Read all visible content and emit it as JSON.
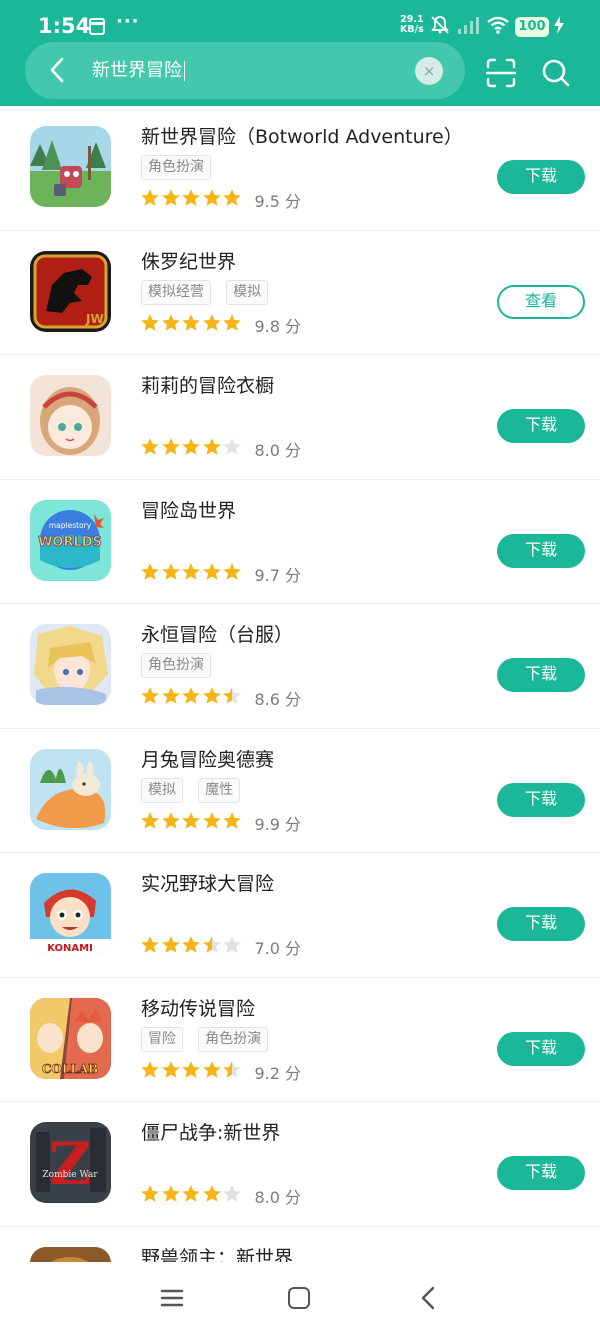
{
  "status": {
    "time": "1:54",
    "dots": "···",
    "speed_value": "29.1",
    "speed_unit": "KB/s",
    "battery": "100"
  },
  "search": {
    "query": "新世界冒险",
    "clear_label": "×"
  },
  "apps": [
    {
      "name": "新世界冒险（Botworld Adventure）",
      "tags": [
        "角色扮演"
      ],
      "rating": 5,
      "score": "9.5 分",
      "action": "下载",
      "style": "filled"
    },
    {
      "name": "侏罗纪世界",
      "tags": [
        "模拟经营",
        "模拟"
      ],
      "rating": 5,
      "score": "9.8 分",
      "action": "查看",
      "style": "outline"
    },
    {
      "name": "莉莉的冒险衣橱",
      "tags": [],
      "rating": 4,
      "score": "8.0 分",
      "action": "下载",
      "style": "filled"
    },
    {
      "name": "冒险岛世界",
      "tags": [],
      "rating": 5,
      "score": "9.7 分",
      "action": "下载",
      "style": "filled"
    },
    {
      "name": "永恒冒险（台服）",
      "tags": [
        "角色扮演"
      ],
      "rating": 4.5,
      "score": "8.6 分",
      "action": "下载",
      "style": "filled"
    },
    {
      "name": "月兔冒险奥德赛",
      "tags": [
        "模拟",
        "魔性"
      ],
      "rating": 5,
      "score": "9.9 分",
      "action": "下载",
      "style": "filled"
    },
    {
      "name": "实况野球大冒险",
      "tags": [],
      "rating": 3.5,
      "score": "7.0 分",
      "action": "下载",
      "style": "filled"
    },
    {
      "name": "移动传说冒险",
      "tags": [
        "冒险",
        "角色扮演"
      ],
      "rating": 4.5,
      "score": "9.2 分",
      "action": "下载",
      "style": "filled"
    },
    {
      "name": "僵尸战争:新世界",
      "tags": [],
      "rating": 4,
      "score": "8.0 分",
      "action": "下载",
      "style": "filled"
    },
    {
      "name": "野兽领主：新世界",
      "tags": [],
      "rating": 0,
      "score": "",
      "action": "",
      "style": "filled"
    }
  ],
  "icon_texts": {
    "jurassic": "JW",
    "maplestory_top": "maplestory",
    "maplestory_main": "WORLDS",
    "konami": "KONAMI",
    "collab": "COLLAB",
    "zombie_letter": "Z",
    "zombie_word": "Zombie War"
  },
  "colors": {
    "primary": "#1bb799",
    "star": "#f6b417",
    "star_empty": "#e2e2e2"
  }
}
